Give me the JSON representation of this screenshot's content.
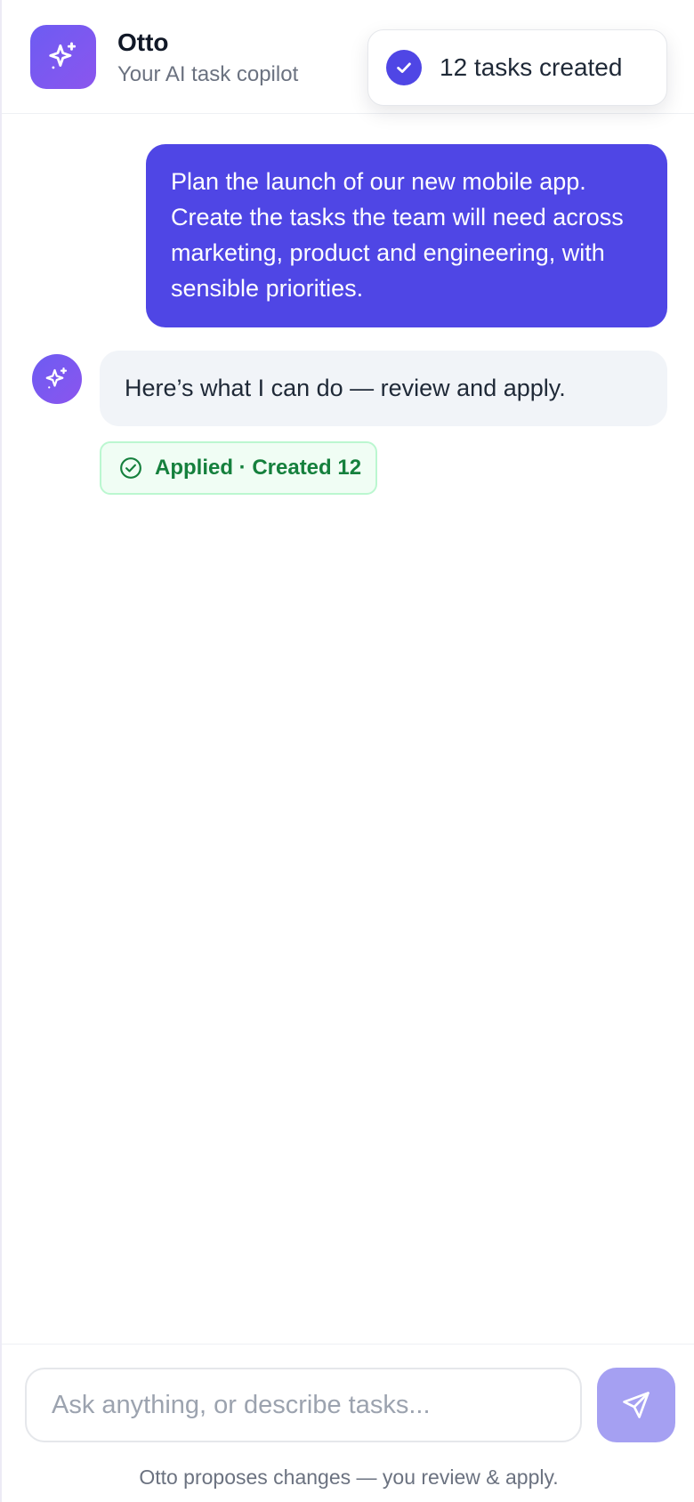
{
  "header": {
    "app_name": "Otto",
    "subtitle": "Your AI task copilot",
    "logo_icon": "sparkles-icon"
  },
  "toast": {
    "icon": "check-circle-icon",
    "text": "12 tasks created"
  },
  "messages": {
    "user": {
      "text": "Plan the launch of our new mobile app. Create the tasks the team will need across marketing, product and engineering, with sensible priorities."
    },
    "assistant": {
      "avatar_icon": "sparkles-icon",
      "text": "Here’s what I can do — review and apply.",
      "badge": {
        "icon": "check-circle-outline-icon",
        "text": "Applied · Created 12"
      }
    }
  },
  "composer": {
    "placeholder": "Ask anything, or describe tasks...",
    "value": "",
    "send_icon": "send-icon",
    "hint": "Otto proposes changes — you review & apply."
  },
  "colors": {
    "primary": "#4f46e5",
    "accent_gradient_start": "#6d5cf2",
    "accent_gradient_end": "#8b55ee",
    "success": "#15803d",
    "success_bg": "#f0fdf4",
    "send_disabled": "#a5a0f2"
  }
}
